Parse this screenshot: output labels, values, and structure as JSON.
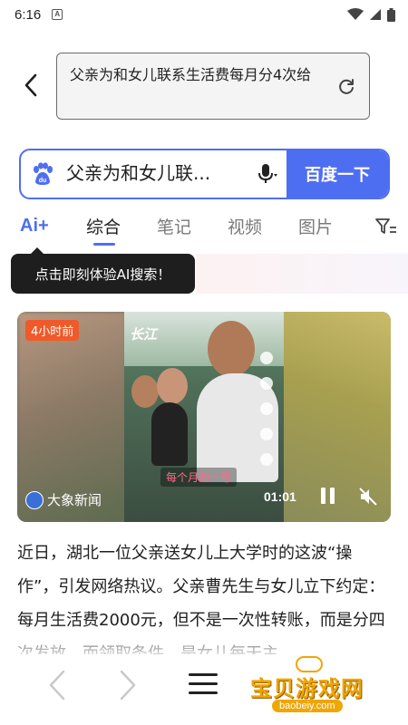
{
  "status_bar": {
    "time": "6:16",
    "notification_icon": "A"
  },
  "query_bar": {
    "text": "父亲为和女儿联系生活费每月分4次给",
    "back_icon": "chevron-left-icon",
    "refresh_icon": "refresh-icon"
  },
  "search": {
    "query": "父亲为和女儿联...",
    "submit_label": "百度一下",
    "accent": "#4e6ef2"
  },
  "tabs": {
    "ai_label": "Ai+",
    "items": [
      {
        "label": "综合",
        "active": true
      },
      {
        "label": "笔记",
        "active": false
      },
      {
        "label": "视频",
        "active": false
      },
      {
        "label": "图片",
        "active": false
      }
    ]
  },
  "tooltip": {
    "text": "点击即刻体验AI搜索！"
  },
  "video": {
    "age_badge": "4小时前",
    "badge_color": "#f05a2a",
    "source": "大象新闻",
    "brand": "长江",
    "subtitle": "每个月的一号",
    "duration": "01:01"
  },
  "article": {
    "text": "近日，湖北一位父亲送女儿上大学时的这波“操作”，引发网络热议。父亲曹先生与女儿立下约定：每月生活费2000元，但不是一次性转账，而是分四次发放，而领取条件，是女儿每天主"
  },
  "watermark": {
    "text": "宝贝游戏网",
    "url": "baobeiy.com",
    "color": "#f0a500"
  }
}
